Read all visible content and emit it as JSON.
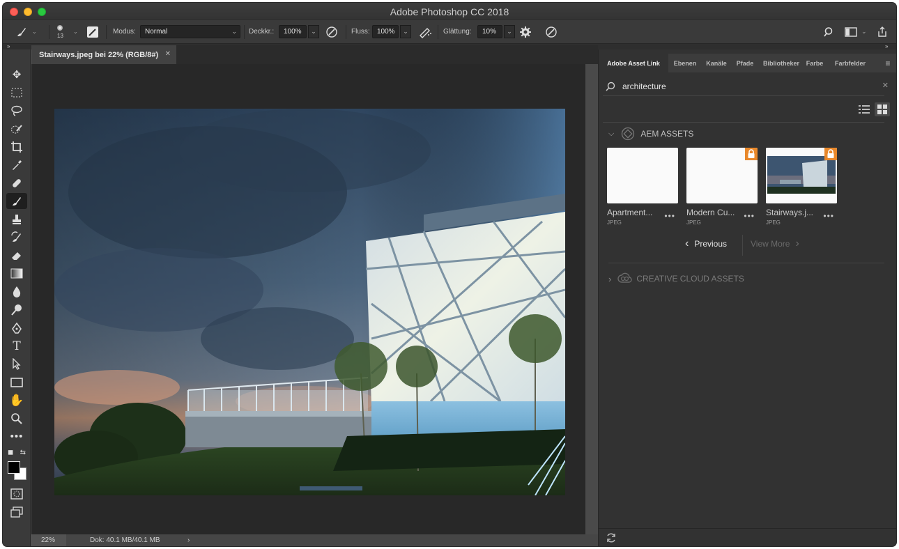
{
  "window": {
    "title": "Adobe Photoshop CC 2018"
  },
  "options_bar": {
    "brush_size": "13",
    "mode_label": "Modus:",
    "mode_value": "Normal",
    "opacity_label": "Deckkr.:",
    "opacity_value": "100%",
    "flow_label": "Fluss:",
    "flow_value": "100%",
    "smoothing_label": "Glättung:",
    "smoothing_value": "10%"
  },
  "document": {
    "tab_title": "Stairways.jpeg bei 22% (RGB/8#)",
    "zoom": "22%",
    "doc_size": "Dok: 40.1 MB/40.1 MB"
  },
  "panel": {
    "tabs": [
      "Adobe Asset Link",
      "Ebenen",
      "Kanäle",
      "Pfade",
      "Bibliotheken",
      "Farbe",
      "Farbfelder"
    ],
    "search_value": "architecture",
    "aem_section": "AEM ASSETS",
    "cc_section": "CREATIVE CLOUD ASSETS",
    "assets": [
      {
        "name": "Apartment...",
        "type": "JPEG",
        "locked": false
      },
      {
        "name": "Modern Cu...",
        "type": "JPEG",
        "locked": true
      },
      {
        "name": "Stairways.j...",
        "type": "JPEG",
        "locked": true
      }
    ],
    "previous_label": "Previous",
    "view_more_label": "View More"
  },
  "colors": {
    "accent_lock": "#e8882b",
    "ui_bg": "#535353"
  }
}
